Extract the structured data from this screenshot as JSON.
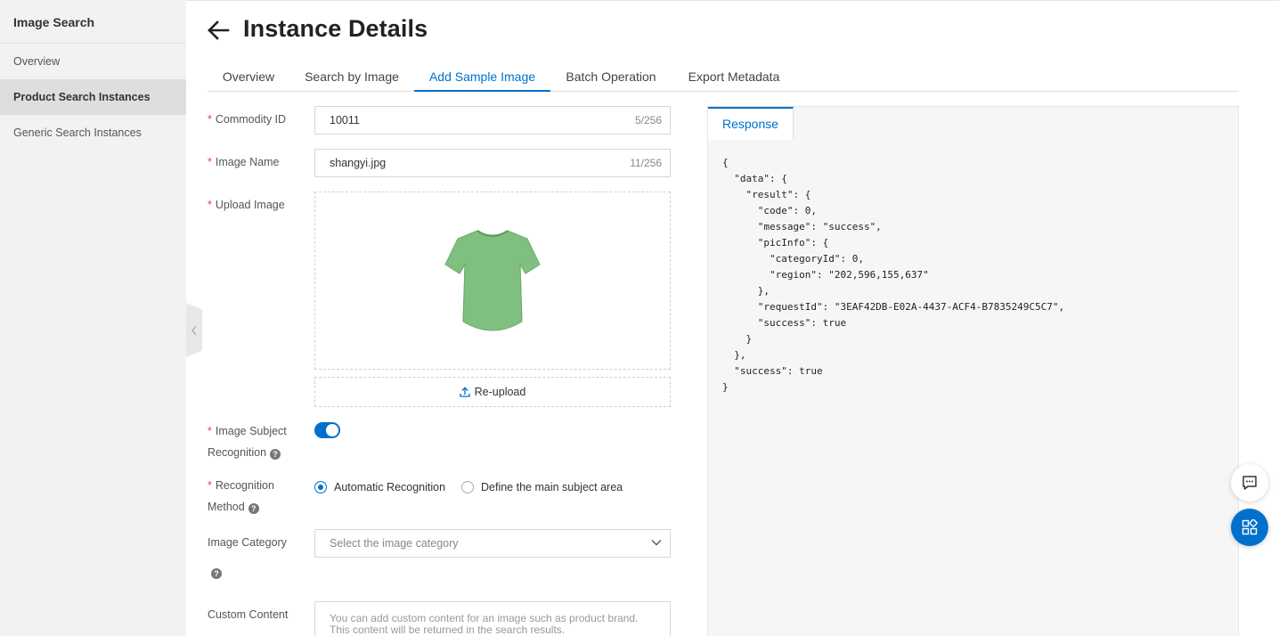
{
  "sidebar": {
    "title": "Image Search",
    "items": [
      {
        "label": "Overview"
      },
      {
        "label": "Product Search Instances"
      },
      {
        "label": "Generic Search Instances"
      }
    ]
  },
  "header": {
    "title": "Instance Details"
  },
  "tabs": [
    {
      "label": "Overview"
    },
    {
      "label": "Search by Image"
    },
    {
      "label": "Add Sample Image"
    },
    {
      "label": "Batch Operation"
    },
    {
      "label": "Export Metadata"
    }
  ],
  "form": {
    "commodity_id": {
      "label": "Commodity ID",
      "value": "10011",
      "count": "5/256"
    },
    "image_name": {
      "label": "Image Name",
      "value": "shangyi.jpg",
      "count": "11/256"
    },
    "upload_image": {
      "label": "Upload Image",
      "reupload_label": "Re-upload"
    },
    "subject_recognition": {
      "label_line1": "Image Subject",
      "label_line2": "Recognition",
      "enabled": true
    },
    "recognition_method": {
      "label_line1": "Recognition",
      "label_line2": "Method",
      "options": [
        {
          "label": "Automatic Recognition",
          "selected": true
        },
        {
          "label": "Define the main subject area",
          "selected": false
        }
      ]
    },
    "image_category": {
      "label": "Image Category",
      "placeholder": "Select the image category"
    },
    "custom_content": {
      "label": "Custom Content",
      "placeholder": "You can add custom content for an image such as product brand. This content will be returned in the search results."
    }
  },
  "response": {
    "tab_label": "Response",
    "code": "{\n  \"data\": {\n    \"result\": {\n      \"code\": 0,\n      \"message\": \"success\",\n      \"picInfo\": {\n        \"categoryId\": 0,\n        \"region\": \"202,596,155,637\"\n      },\n      \"requestId\": \"3EAF42DB-E02A-4437-ACF4-B7835249C5C7\",\n      \"success\": true\n    }\n  },\n  \"success\": true\n}"
  },
  "icons": {
    "back": "arrow-left-icon",
    "upload": "upload-icon",
    "help": "question-icon",
    "chevron": "chevron-down-icon",
    "chat": "chat-icon",
    "apps": "apps-icon",
    "collapse": "chevron-left-icon"
  },
  "colors": {
    "accent": "#0070cc",
    "brand": "#ff6a00",
    "required": "#e8433f",
    "shirt": "#7fbf7f"
  }
}
